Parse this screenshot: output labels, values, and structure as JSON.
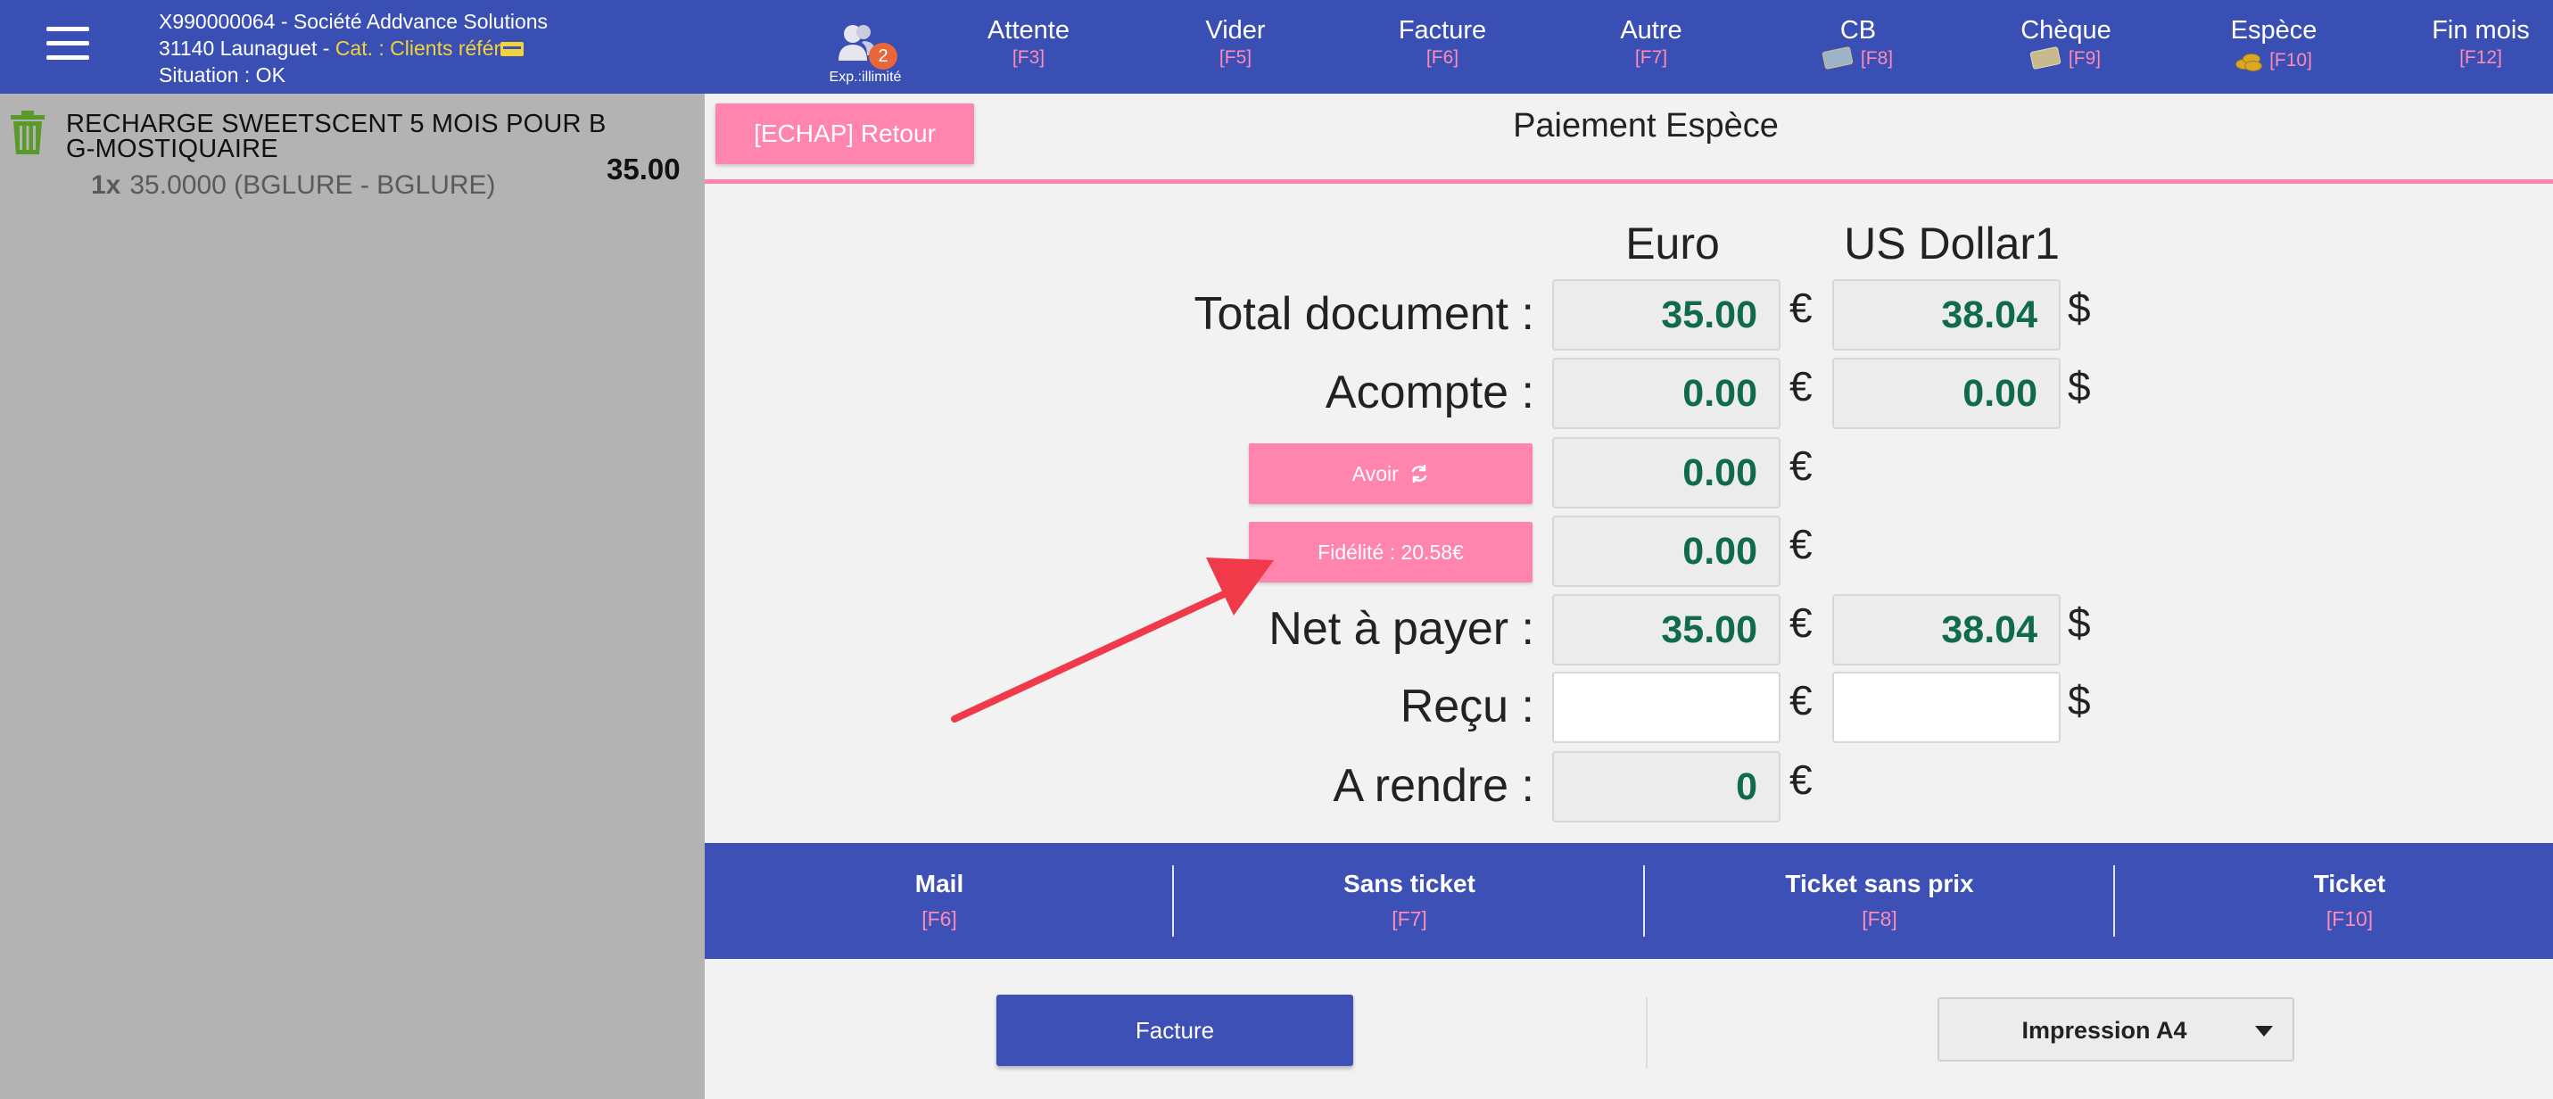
{
  "header": {
    "client_line1": "X990000064 - Société Addvance Solutions",
    "client_line2_prefix": "31140 Launaguet - ",
    "client_category": "Cat. : Clients référ",
    "client_situation": "Situation : OK",
    "user_badge_count": "2",
    "user_label": "Exp.:illimité",
    "actions": [
      {
        "label": "Attente",
        "key": "[F3]"
      },
      {
        "label": "Vider",
        "key": "[F5]"
      },
      {
        "label": "Facture",
        "key": "[F6]"
      },
      {
        "label": "Autre",
        "key": "[F7]"
      },
      {
        "label": "CB",
        "key": "[F8]"
      },
      {
        "label": "Chèque",
        "key": "[F9]"
      },
      {
        "label": "Espèce",
        "key": "[F10]"
      },
      {
        "label": "Fin mois",
        "key": "[F12]"
      }
    ]
  },
  "ticket": {
    "line_title": "RECHARGE SWEETSCENT 5 MOIS POUR B G-MOSTIQUAIRE",
    "line_qty": "1x",
    "line_detail": "35.0000 (BGLURE - BGLURE)",
    "line_total": "35.00"
  },
  "payment": {
    "back_button": "[ECHAP] Retour",
    "title": "Paiement Espèce",
    "currency_eur": "Euro",
    "currency_usd": "US Dollar1",
    "eur_symbol": "€",
    "usd_symbol": "$",
    "labels": {
      "total": "Total document :",
      "acompte": "Acompte :",
      "net": "Net à payer :",
      "recu": "Reçu :",
      "rendre": "A rendre :"
    },
    "avoir_button": "Avoir",
    "fidelite_button": "Fidélité : 20.58€",
    "values": {
      "total_eur": "35.00",
      "total_usd": "38.04",
      "acompte_eur": "0.00",
      "acompte_usd": "0.00",
      "avoir_eur": "0.00",
      "fidelite_eur": "0.00",
      "net_eur": "35.00",
      "net_usd": "38.04",
      "recu_eur": "",
      "recu_usd": "",
      "rendre_eur": "0"
    }
  },
  "print_options": [
    {
      "label": "Mail",
      "key": "[F6]"
    },
    {
      "label": "Sans ticket",
      "key": "[F7]"
    },
    {
      "label": "Ticket sans prix",
      "key": "[F8]"
    },
    {
      "label": "Ticket",
      "key": "[F10]"
    }
  ],
  "footer": {
    "facture_button": "Facture",
    "impression_value": "Impression A4"
  },
  "colors": {
    "header_bg": "#3a4fb4",
    "accent_pink": "#ff85ae",
    "amount_green": "#0f6b4a",
    "arrow_red": "#f03a4a",
    "trash_green": "#5a9a2a"
  }
}
